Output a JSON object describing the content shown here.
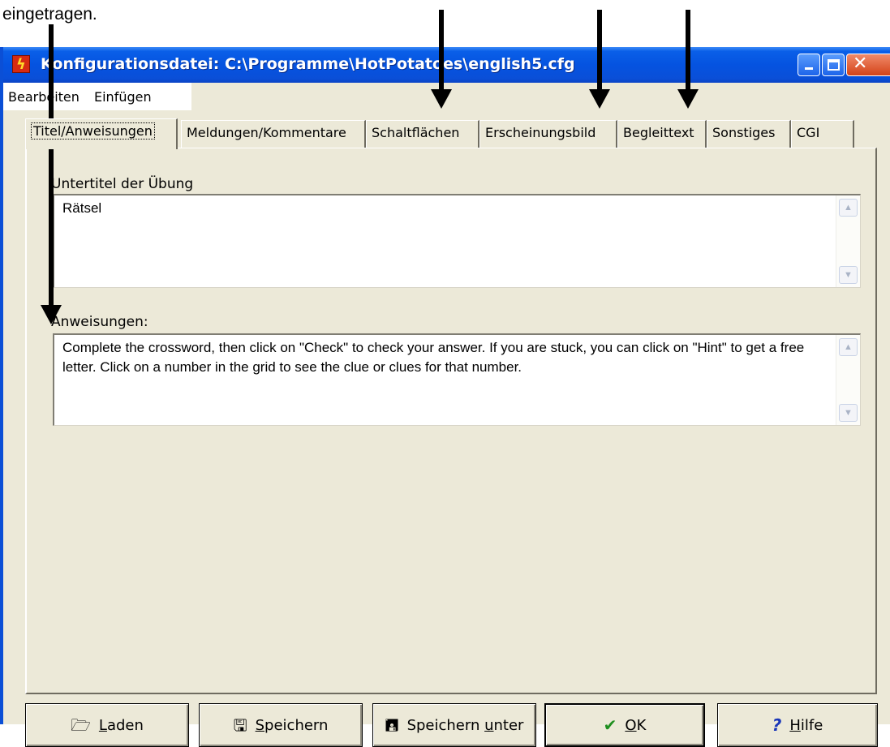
{
  "doc": {
    "fragment": "eingetragen."
  },
  "window": {
    "title": "Konfigurationsdatei: C:\\Programme\\HotPotatoes\\english5.cfg",
    "colors": {
      "titlebar": "#0553e0",
      "client": "#ece9d8",
      "close": "#d44318"
    }
  },
  "menu": {
    "items": [
      "Bearbeiten",
      "Einfügen"
    ]
  },
  "tabs": [
    {
      "label": "Titel/Anweisungen",
      "active": true
    },
    {
      "label": "Meldungen/Kommentare"
    },
    {
      "label": "Schaltflächen"
    },
    {
      "label": "Erscheinungsbild"
    },
    {
      "label": "Begleittext"
    },
    {
      "label": "Sonstiges"
    },
    {
      "label": "CGI"
    }
  ],
  "form": {
    "subtitle_label": "Untertitel der Übung",
    "subtitle_value": "Rätsel",
    "instructions_label": "Anweisungen:",
    "instructions_value": "Complete the crossword, then click on \"Check\" to check your answer. If you are stuck, you can click on \"Hint\" to get a free letter. Click on a number in the grid to see the clue or clues for that number."
  },
  "buttons": {
    "load": {
      "mnemonic": "L",
      "rest": "aden",
      "icon": "folder-open-icon"
    },
    "save": {
      "mnemonic": "S",
      "rest": "peichern",
      "icon": "floppy-disk-icon"
    },
    "save_as": {
      "pre": "Speichern ",
      "mnemonic": "u",
      "rest": "nter",
      "icon": "floppy-question-icon"
    },
    "ok": {
      "mnemonic": "O",
      "rest": "K",
      "icon": "checkmark-icon"
    },
    "help": {
      "mnemonic": "H",
      "rest": "ilfe",
      "icon": "question-mark-icon"
    }
  }
}
